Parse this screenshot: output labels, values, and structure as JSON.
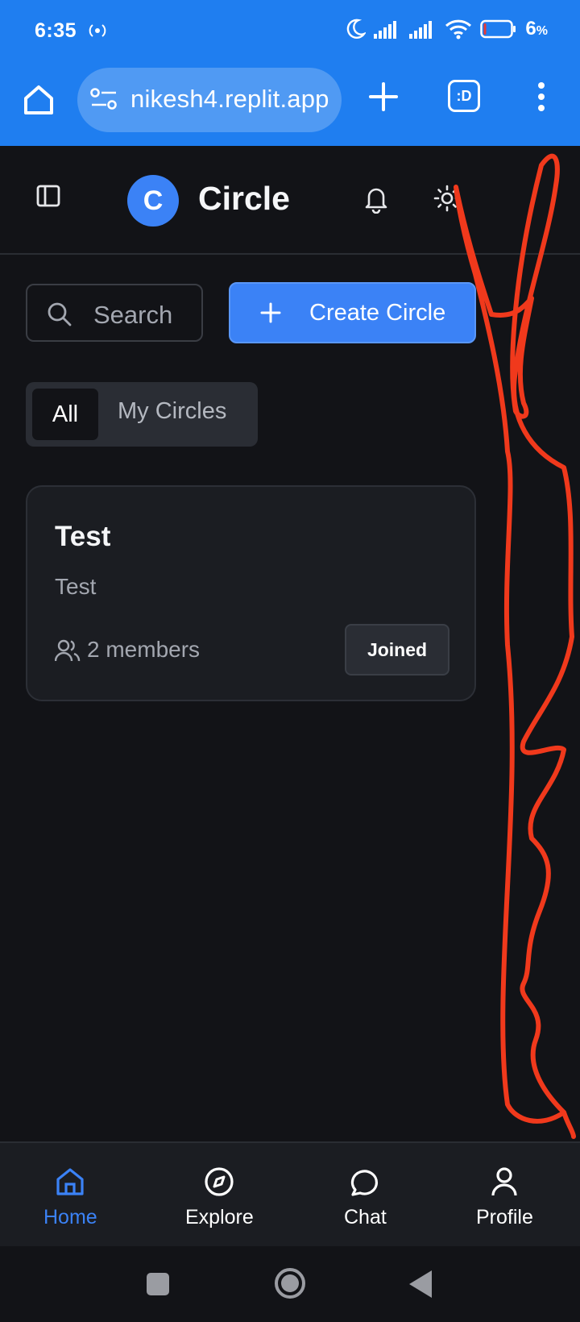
{
  "status_bar": {
    "time": "6:35",
    "battery_percent": "6",
    "battery_unit": "%",
    "battery_level": 0.06
  },
  "browser": {
    "url": "nikesh4.replit.app",
    "extension_label": ":D"
  },
  "header": {
    "logo_letter": "C",
    "title": "Circle"
  },
  "controls": {
    "search_placeholder": "Search",
    "create_label": "Create Circle"
  },
  "tabs": [
    {
      "label": "All",
      "active": true
    },
    {
      "label": "My Circles",
      "active": false
    }
  ],
  "circles": [
    {
      "title": "Test",
      "description": "Test",
      "members": "2 members",
      "status": "Joined"
    }
  ],
  "bottom_nav": [
    {
      "label": "Home",
      "icon": "home-icon",
      "active": true
    },
    {
      "label": "Explore",
      "icon": "compass-icon",
      "active": false
    },
    {
      "label": "Chat",
      "icon": "chat-bubble-icon",
      "active": false
    },
    {
      "label": "Profile",
      "icon": "user-icon",
      "active": false
    }
  ],
  "colors": {
    "browser_bar": "#1f7ef0",
    "accent": "#3b82f6",
    "background": "#121317",
    "card": "#1b1d22",
    "annotation": "#f0391c"
  }
}
